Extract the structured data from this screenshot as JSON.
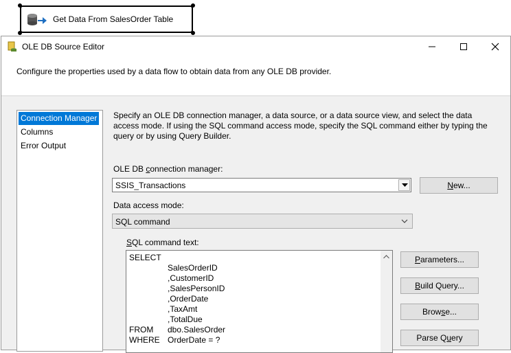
{
  "designer": {
    "task_label": "Get Data From SalesOrder Table"
  },
  "window": {
    "title": "OLE DB Source Editor",
    "header": "Configure the properties used by a data flow to obtain data from any OLE DB provider."
  },
  "nav": {
    "items": [
      {
        "label": "Connection Manager",
        "selected": true
      },
      {
        "label": "Columns",
        "selected": false
      },
      {
        "label": "Error Output",
        "selected": false
      }
    ]
  },
  "connection_page": {
    "description": "Specify an OLE DB connection manager, a data source, or a data source view, and select the data access mode. If using the SQL command access mode, specify the SQL command either by typing the query or by using Query Builder.",
    "connection_manager_label_pre": "OLE DB ",
    "connection_manager_label_ul": "c",
    "connection_manager_label_post": "onnection manager:",
    "connection_manager_value": "SSIS_Transactions",
    "new_button_pre": "",
    "new_button_ul": "N",
    "new_button_post": "ew...",
    "data_access_label": "Data access mode:",
    "data_access_value": "SQL command",
    "sql_label_pre": "",
    "sql_label_ul": "S",
    "sql_label_post": "QL command text:",
    "sql_lines": [
      {
        "kw": "SELECT",
        "text": ""
      },
      {
        "kw": "",
        "text": "SalesOrderID"
      },
      {
        "kw": "",
        "text": ",CustomerID"
      },
      {
        "kw": "",
        "text": ",SalesPersonID"
      },
      {
        "kw": "",
        "text": ",OrderDate"
      },
      {
        "kw": "",
        "text": ",TaxAmt"
      },
      {
        "kw": "",
        "text": ",TotalDue"
      },
      {
        "kw": "FROM",
        "text": "dbo.SalesOrder"
      },
      {
        "kw": "WHERE",
        "text": "OrderDate = ?"
      }
    ],
    "buttons": {
      "parameters": {
        "pre": "",
        "ul": "P",
        "post": "arameters..."
      },
      "build_query": {
        "pre": "",
        "ul": "B",
        "post": "uild Query..."
      },
      "browse": {
        "pre": "Brow",
        "ul": "s",
        "post": "e..."
      },
      "parse_query": {
        "pre": "Parse Q",
        "ul": "u",
        "post": "ery"
      }
    }
  },
  "colors": {
    "selection": "#0078d7",
    "dialog_bg": "#f0f0f0"
  }
}
